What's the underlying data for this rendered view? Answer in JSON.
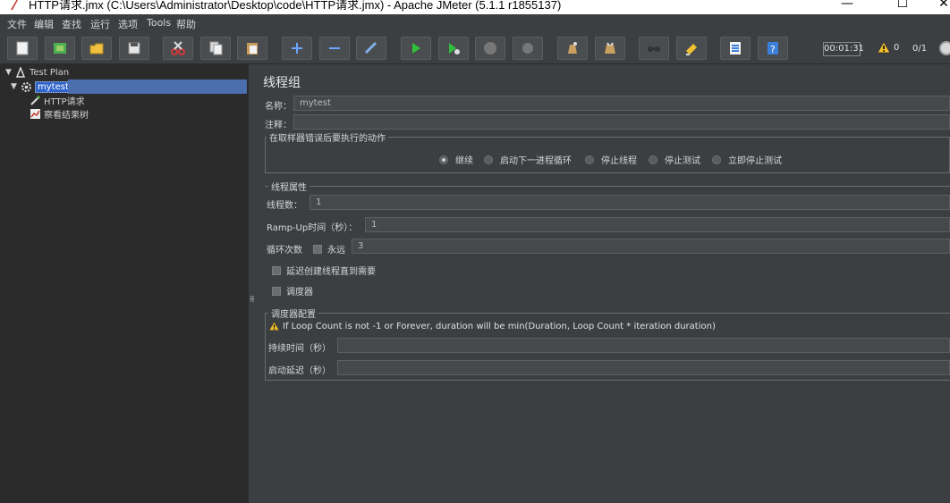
{
  "window": {
    "title": "HTTP请求.jmx (C:\\Users\\Administrator\\Desktop\\code\\HTTP请求.jmx) - Apache JMeter (5.1.1 r1855137)",
    "minimize": "—",
    "maximize": "☐",
    "close": "✕"
  },
  "menu": [
    "文件",
    "编辑",
    "查找",
    "运行",
    "选项",
    "Tools",
    "帮助"
  ],
  "toolbar": {
    "buttons": [
      "new-icon",
      "templates-icon",
      "open-icon",
      "save-icon",
      "cut-icon",
      "copy-icon",
      "paste-icon",
      "expand-icon",
      "collapse-icon",
      "toggle-icon",
      "start-icon",
      "start-no-pause-icon",
      "stop-icon",
      "shutdown-icon",
      "clear-icon",
      "clear-all-icon",
      "search-icon",
      "reset-search-icon",
      "function-helper-icon",
      "help-icon"
    ],
    "timer": "00:01:31",
    "warning_count": "0",
    "threads": "0/1",
    "colors": {
      "start": "#2fbf3a",
      "cut": "#d23a3a",
      "help": "#3b7fd9"
    }
  },
  "tree": {
    "root": "Test Plan",
    "thread_group": "mytest",
    "children": [
      "HTTP请求",
      "察看结果树"
    ]
  },
  "panel": {
    "title": "线程组",
    "name_label": "名称：",
    "name_value": "mytest",
    "comment_label": "注释：",
    "comment_value": "",
    "error_action": {
      "title": "在取样器错误后要执行的动作",
      "options": [
        "继续",
        "启动下一进程循环",
        "停止线程",
        "停止测试",
        "立即停止测试"
      ],
      "selected": "继续"
    },
    "thread_props": {
      "title": "线程属性",
      "threads_label": "线程数：",
      "threads_value": "1",
      "rampup_label": "Ramp-Up时间（秒）：",
      "rampup_value": "1",
      "loop_label": "循环次数",
      "forever_label": "永远",
      "loop_value": "3",
      "delay_label": "延迟创建线程直到需要",
      "scheduler_label": "调度器"
    },
    "scheduler": {
      "title": "调度器配置",
      "warning": "If Loop Count is not -1 or Forever, duration will be min(Duration, Loop Count * iteration duration)",
      "duration_label": "持续时间（秒）",
      "duration_value": "",
      "delay_label": "启动延迟（秒）",
      "delay_value": ""
    }
  }
}
